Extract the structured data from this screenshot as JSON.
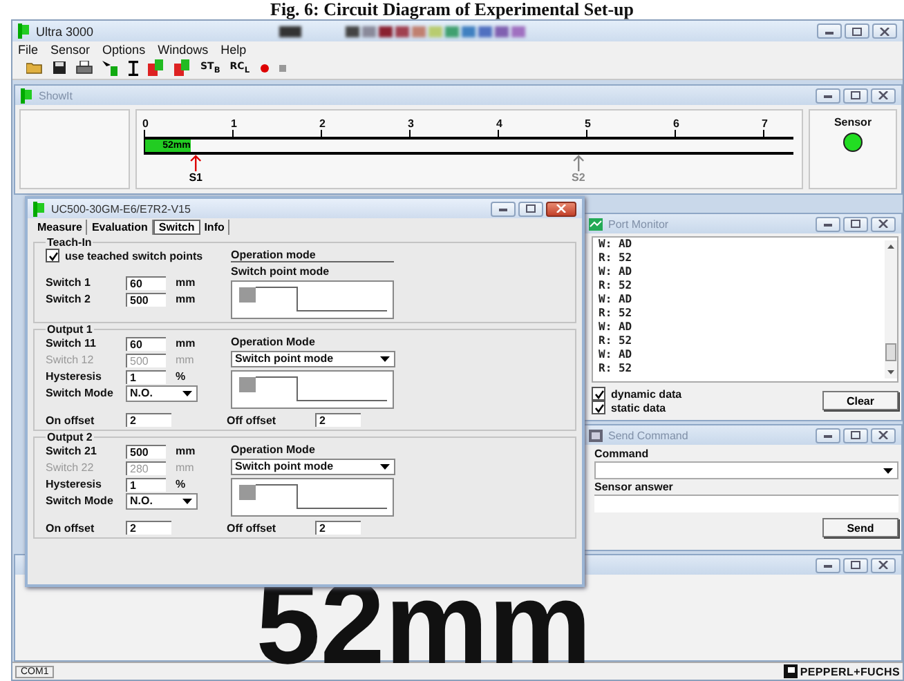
{
  "caption": "Fig. 6: Circuit Diagram of Experimental Set-up",
  "window": {
    "title": "Ultra 3000"
  },
  "menu": [
    "File",
    "Sensor",
    "Options",
    "Windows",
    "Help"
  ],
  "toolbar": [
    {
      "kind": "open"
    },
    {
      "kind": "save"
    },
    {
      "kind": "print"
    },
    {
      "kind": "pointer"
    },
    {
      "kind": "ibeam"
    },
    {
      "kind": "teach"
    },
    {
      "kind": "teach"
    },
    {
      "kind": "text",
      "label": "ST$_{B}$"
    },
    {
      "kind": "text",
      "label": "RC$_{L}$"
    },
    {
      "kind": "record"
    },
    {
      "kind": "stop"
    }
  ],
  "showit": {
    "title": "ShowIt",
    "ticks": [
      "0",
      "1",
      "2",
      "3",
      "4",
      "5",
      "6",
      "7"
    ],
    "bar": {
      "label": "52mm",
      "level": 0.07
    },
    "markers": [
      {
        "label": "S1",
        "kind": "active",
        "level": 0.08
      },
      {
        "label": "S2",
        "kind": "inactive",
        "level": 0.669
      }
    ],
    "sensor": {
      "label": "Sensor",
      "on": true
    }
  },
  "dialog": {
    "title": "UC500-30GM-E6/E7R2-V15",
    "tabs": [
      {
        "label": "Measure",
        "selected": false
      },
      {
        "label": "Evaluation",
        "selected": false
      },
      {
        "label": "Switch",
        "selected": true
      },
      {
        "label": "Info",
        "selected": false
      }
    ],
    "teach_in": {
      "title": "Teach-In",
      "checkbox": {
        "label": "use teached switch points",
        "checked": true
      },
      "mode_label": "Operation mode",
      "mode_value": "Switch point mode",
      "fields": [
        {
          "label": "Switch 1",
          "value": "60",
          "unit": "mm",
          "disabled": false
        },
        {
          "label": "Switch 2",
          "value": "500",
          "unit": "mm",
          "disabled": false
        }
      ]
    },
    "outputs": [
      {
        "title": "Output 1",
        "fields": [
          {
            "label": "Switch 11",
            "value": "60",
            "unit": "mm",
            "disabled": false
          },
          {
            "label": "Switch 12",
            "value": "500",
            "unit": "mm",
            "disabled": true
          },
          {
            "label": "Hysteresis",
            "value": "1",
            "unit": "%",
            "disabled": false
          }
        ],
        "switch_mode": {
          "label": "Switch Mode",
          "value": "N.O."
        },
        "mode_label": "Operation Mode",
        "mode_value": "Switch point mode",
        "on_offset": {
          "label": "On offset",
          "value": "2"
        },
        "off_offset": {
          "label": "Off offset",
          "value": "2"
        }
      },
      {
        "title": "Output 2",
        "fields": [
          {
            "label": "Switch 21",
            "value": "500",
            "unit": "mm",
            "disabled": false
          },
          {
            "label": "Switch 22",
            "value": "280",
            "unit": "mm",
            "disabled": true
          },
          {
            "label": "Hysteresis",
            "value": "1",
            "unit": "%",
            "disabled": false
          }
        ],
        "switch_mode": {
          "label": "Switch Mode",
          "value": "N.O."
        },
        "mode_label": "Operation Mode",
        "mode_value": "Switch point mode",
        "on_offset": {
          "label": "On offset",
          "value": "2"
        },
        "off_offset": {
          "label": "Off offset",
          "value": "2"
        }
      }
    ]
  },
  "port_monitor": {
    "title": "Port Monitor",
    "lines": [
      "W: AD",
      "R: 52",
      "W: AD",
      "R: 52",
      "W: AD",
      "R: 52",
      "W: AD",
      "R: 52",
      "W: AD",
      "R: 52"
    ],
    "checkboxes": [
      {
        "label": "dynamic data",
        "checked": true
      },
      {
        "label": "static data",
        "checked": true
      }
    ],
    "button": "Clear"
  },
  "send_command": {
    "title": "Send Command",
    "command_label": "Command",
    "answer_label": "Sensor answer",
    "button": "Send"
  },
  "display": {
    "value": "52mm"
  },
  "status_bar": {
    "port": "COM1",
    "logo": "PEPPERL+FUCHS"
  }
}
